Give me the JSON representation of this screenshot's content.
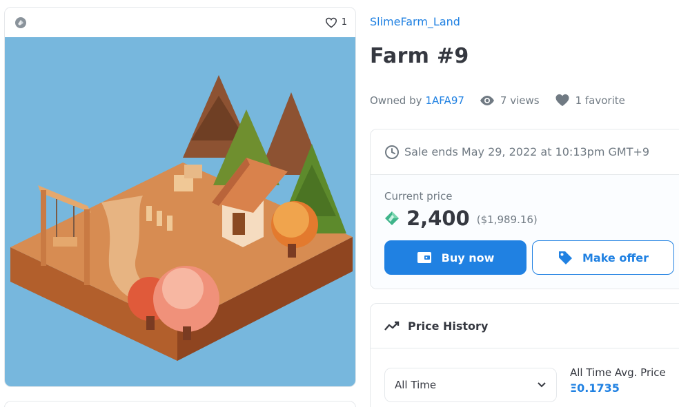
{
  "media": {
    "favorite_count": "1",
    "background_color": "#77b7dd"
  },
  "item": {
    "collection_name": "SlimeFarm_Land",
    "title": "Farm #9",
    "owned_by_label": "Owned by",
    "owner": "1AFA97",
    "views": "7 views",
    "favorites": "1 favorite"
  },
  "sale": {
    "ends_text": "Sale ends May 29, 2022 at 10:13pm GMT+9",
    "current_price_label": "Current price",
    "price": "2,400",
    "price_usd": "($1,989.16)",
    "buy_label": "Buy now",
    "offer_label": "Make offer"
  },
  "history": {
    "title": "Price History",
    "selected_range": "All Time",
    "avg_label": "All Time Avg. Price",
    "avg_value": "Ξ0.1735"
  },
  "colors": {
    "accent": "#2081e2",
    "text": "#353840",
    "muted": "#707a83"
  },
  "icons": [
    "chain-icon",
    "heart-icon",
    "eye-icon",
    "heart-filled-icon",
    "clock-icon",
    "token-icon",
    "wallet-icon",
    "tag-icon",
    "trend-icon",
    "chevron-down-icon"
  ]
}
